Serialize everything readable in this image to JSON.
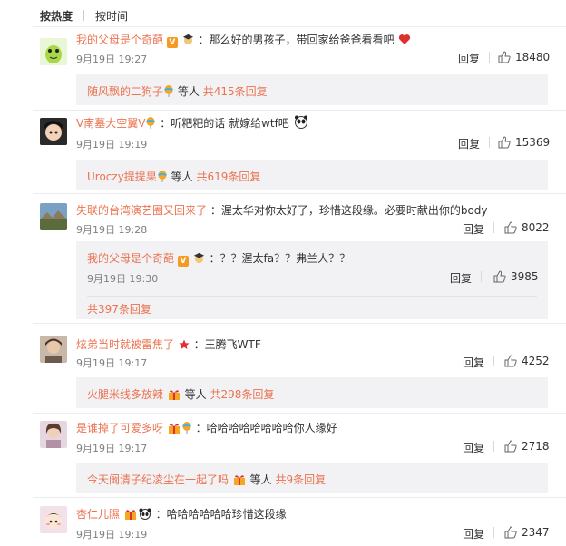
{
  "sort": {
    "hot": "按热度",
    "time": "按时间"
  },
  "colors": {
    "username": "#eb7350",
    "subbox": "#f2f2f5",
    "text": "#333333",
    "meta": "#808080"
  },
  "comments": [
    {
      "user": "我的父母是个奇葩",
      "text": "：那么好的男孩子，带回家给爸爸看看吧",
      "time": "9月19日 19:27",
      "reply": "回复",
      "likes": "18480",
      "sub": {
        "user": "随风飘的二狗子",
        "suffix": "等人",
        "count": "共415条回复"
      }
    },
    {
      "user": "V南墓大空翼V",
      "text": "：听粑粑的话 就嫁给wtf吧",
      "time": "9月19日 19:19",
      "reply": "回复",
      "likes": "15369",
      "sub": {
        "user": "Uroczy提提果",
        "suffix": "等人",
        "count": "共619条回复"
      }
    },
    {
      "user": "失联的台湾演艺圈又回来了",
      "text": "：渥太华对你太好了，珍惜这段缘。必要时献出你的body",
      "time": "9月19日 19:28",
      "reply": "回复",
      "likes": "8022",
      "nested": {
        "user": "我的父母是个奇葩",
        "text": "：？？渥太fa？？弗兰人？？",
        "time": "9月19日 19:30",
        "reply": "回复",
        "likes": "3985",
        "count": "共397条回复"
      }
    },
    {
      "user": "炫弟当时就被雷焦了",
      "text": "：王腾飞WTF",
      "time": "9月19日 19:17",
      "reply": "回复",
      "likes": "4252",
      "sub": {
        "user": "火腿米线多放辣",
        "suffix": "等人",
        "count": "共298条回复"
      }
    },
    {
      "user": "是谁掉了可爱多呀",
      "text": "：哈哈哈哈哈哈哈哈你人缘好",
      "time": "9月19日 19:17",
      "reply": "回复",
      "likes": "2718",
      "sub": {
        "user": "今天阚清子纪凌尘在一起了吗",
        "suffix": "等人",
        "count": "共9条回复"
      }
    },
    {
      "user": "杏仁儿隰",
      "text": "：哈哈哈哈哈哈珍惜这段缘",
      "time": "9月19日 19:19",
      "reply": "回复",
      "likes": "2347"
    }
  ]
}
